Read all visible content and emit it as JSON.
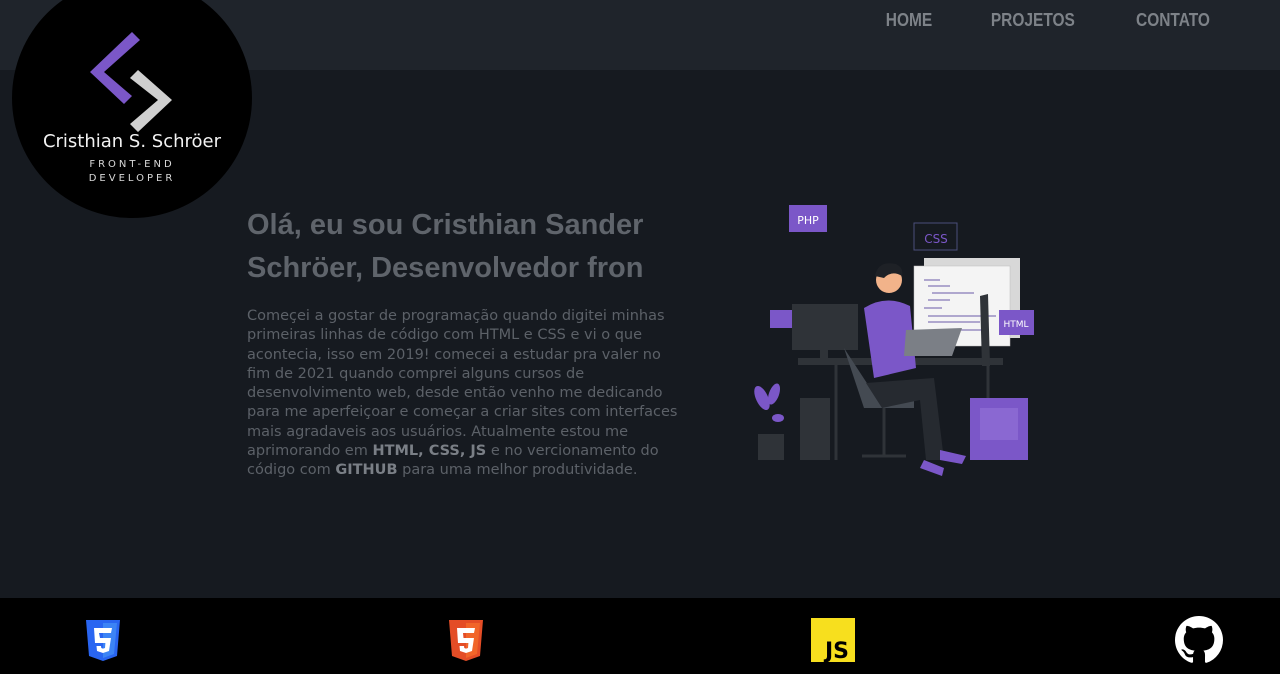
{
  "nav": {
    "items": [
      "HOME",
      "PROJETOS",
      "CONTATO"
    ]
  },
  "logo": {
    "name": "Cristhian S. Schröer",
    "role_line1": "FRONT-END",
    "role_line2": "DEVELOPER"
  },
  "hero": {
    "headline": "Olá, eu sou Cristhian Sander Schröer, Desenvolvedor fron",
    "about": {
      "p1": "Começei a gostar de programação quando digitei minhas primeiras linhas de código com HTML e CSS e vi o que acontecia, isso em 2019! comecei a estudar pra valer no fim de 2021 quando comprei alguns cursos de desenvolvimento web, desde então venho me dedicando para me aperfeiçoar e começar a criar sites com interfaces mais agradaveis aos usuários. Atualmente estou me aprimorando em ",
      "strong1": "HTML, CSS, JS",
      "p2": " e no vercionamento do código com ",
      "strong2": "GITHUB",
      "p3": " para uma melhor produtividade."
    }
  },
  "illustration": {
    "tag_php": "PHP",
    "tag_css": "CSS",
    "tag_html": "HTML"
  },
  "footer": {
    "icons": [
      "html5-icon",
      "css3-icon",
      "javascript-icon",
      "github-icon"
    ],
    "js_label": "JS"
  },
  "colors": {
    "accent": "#7b57c8",
    "background": "#161a20",
    "topbar": "#1f242b",
    "footer": "#000000"
  }
}
